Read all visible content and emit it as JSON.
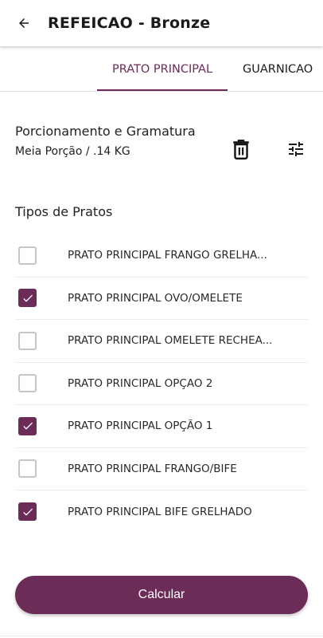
{
  "header": {
    "title": "REFEICAO - Bronze",
    "back_icon": "arrow-left-icon"
  },
  "tabs": [
    {
      "label": "PRATO PRINCIPAL",
      "active": true
    },
    {
      "label": "GUARNICAO",
      "active": false
    }
  ],
  "portion": {
    "title": "Porcionamento e Gramatura",
    "value": "Meia Porção / .14 KG",
    "delete_icon": "trash-icon",
    "filter_icon": "tune-icon"
  },
  "types": {
    "label": "Tipos de Pratos",
    "items": [
      {
        "label": "PRATO PRINCIPAL FRANGO GRELHA...",
        "checked": false
      },
      {
        "label": "PRATO PRINCIPAL OVO/OMELETE",
        "checked": true
      },
      {
        "label": "PRATO PRINCIPAL OMELETE RECHEA...",
        "checked": false
      },
      {
        "label": "PRATO PRINCIPAL OPÇAO 2",
        "checked": false
      },
      {
        "label": "PRATO PRINCIPAL OPÇÃO 1",
        "checked": true
      },
      {
        "label": "PRATO PRINCIPAL FRANGO/BIFE",
        "checked": false
      },
      {
        "label": "PRATO PRINCIPAL BIFE GRELHADO",
        "checked": true
      }
    ]
  },
  "actions": {
    "calculate_label": "Calcular"
  },
  "colors": {
    "accent": "#6b2c57",
    "checkbox_off": "#c6c6c6"
  }
}
